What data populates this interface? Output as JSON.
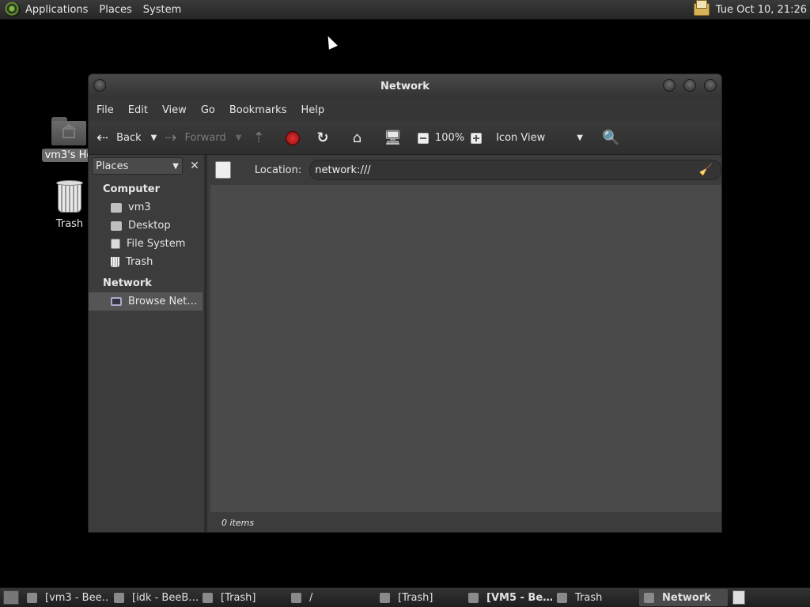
{
  "top_panel": {
    "menus": [
      "Applications",
      "Places",
      "System"
    ],
    "clock": "Tue Oct 10, 21:26"
  },
  "desktop": {
    "home_label": "vm3's Ho",
    "trash_label": "Trash"
  },
  "window": {
    "title": "Network",
    "menu": [
      "File",
      "Edit",
      "View",
      "Go",
      "Bookmarks",
      "Help"
    ],
    "toolbar": {
      "back": "Back",
      "forward": "Forward",
      "zoom": "100%",
      "view_mode": "Icon View"
    },
    "sidebar": {
      "header": "Places",
      "group_computer": "Computer",
      "computer_items": [
        "vm3",
        "Desktop",
        "File System",
        "Trash"
      ],
      "group_network": "Network",
      "network_items": [
        "Browse Net…"
      ]
    },
    "location": {
      "label": "Location:",
      "value": "network:///"
    },
    "status": "0 items"
  },
  "bottom_panel": {
    "tasks": [
      "[vm3 - Bee…",
      "[idk - BeeB…",
      "[Trash]",
      "/",
      "[Trash]",
      "[VM5 - Be…",
      "Trash",
      "Network"
    ]
  }
}
